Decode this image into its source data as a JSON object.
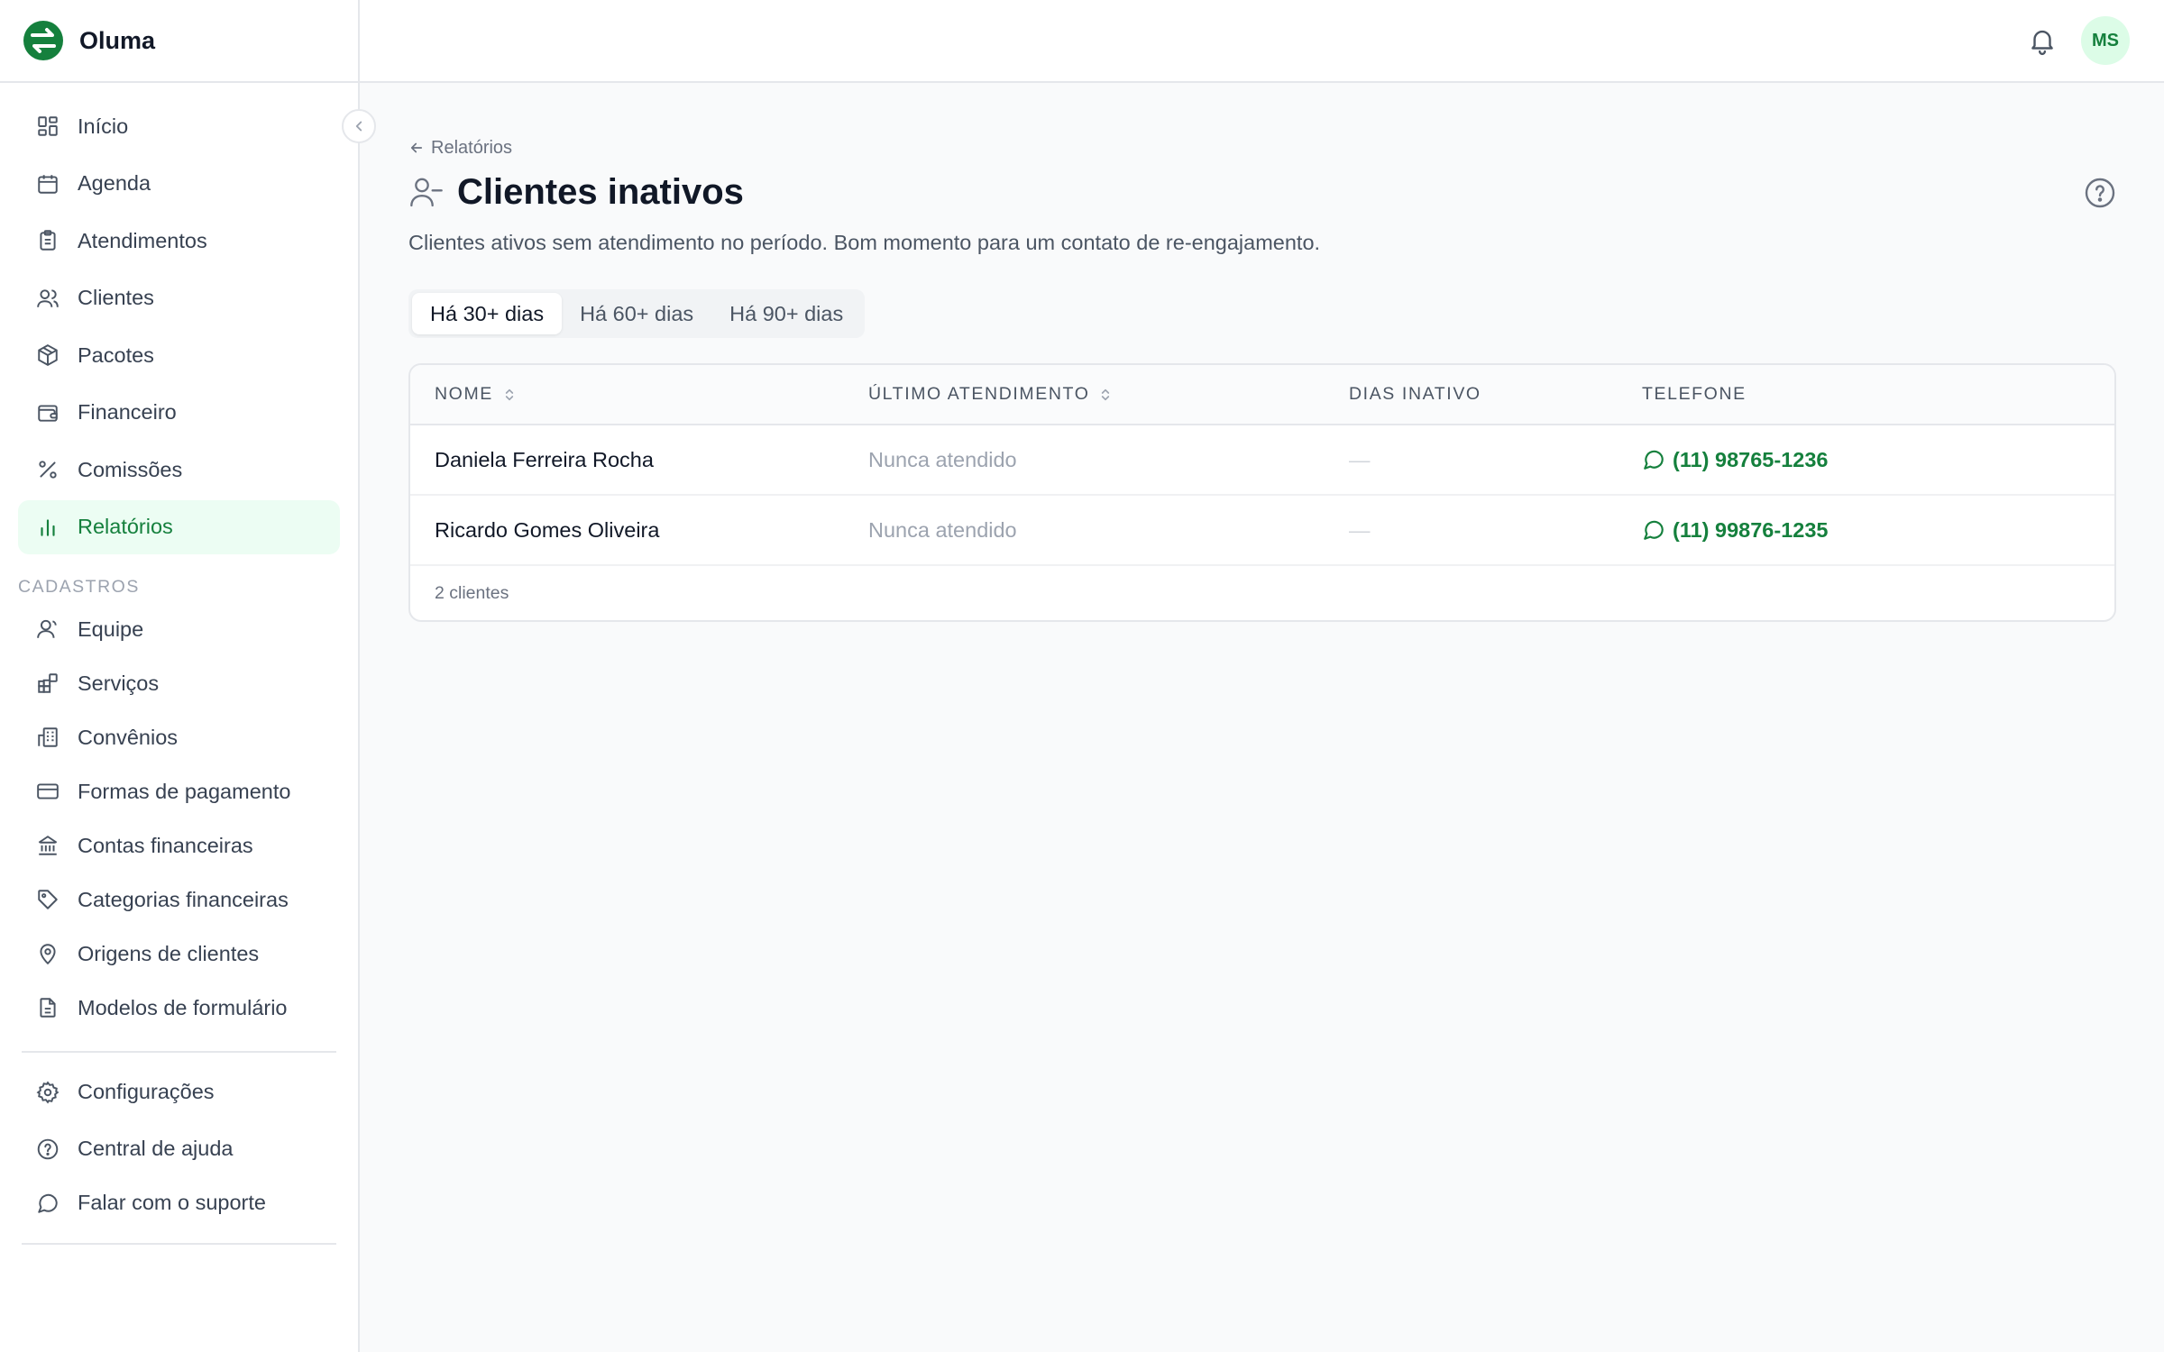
{
  "brand": {
    "name": "Oluma",
    "accent": "#15803d"
  },
  "sidebar": {
    "main_items": [
      {
        "label": "Início",
        "icon": "dashboard-icon"
      },
      {
        "label": "Agenda",
        "icon": "calendar-icon"
      },
      {
        "label": "Atendimentos",
        "icon": "clipboard-icon"
      },
      {
        "label": "Clientes",
        "icon": "users-icon"
      },
      {
        "label": "Pacotes",
        "icon": "package-icon"
      },
      {
        "label": "Financeiro",
        "icon": "wallet-icon"
      },
      {
        "label": "Comissões",
        "icon": "percent-icon"
      },
      {
        "label": "Relatórios",
        "icon": "bar-chart-icon",
        "active": true
      }
    ],
    "section_label": "CADASTROS",
    "cadastro_items": [
      {
        "label": "Equipe",
        "icon": "user-icon"
      },
      {
        "label": "Serviços",
        "icon": "blocks-icon"
      },
      {
        "label": "Convênios",
        "icon": "building-icon"
      },
      {
        "label": "Formas de pagamento",
        "icon": "credit-card-icon"
      },
      {
        "label": "Contas financeiras",
        "icon": "bank-icon"
      },
      {
        "label": "Categorias financeiras",
        "icon": "tag-icon"
      },
      {
        "label": "Origens de clientes",
        "icon": "map-pin-icon"
      },
      {
        "label": "Modelos de formulário",
        "icon": "file-text-icon"
      }
    ],
    "footer_items": [
      {
        "label": "Configurações",
        "icon": "gear-icon"
      },
      {
        "label": "Central de ajuda",
        "icon": "help-circle-icon"
      },
      {
        "label": "Falar com o suporte",
        "icon": "chat-icon"
      }
    ]
  },
  "topbar": {
    "avatar_initials": "MS"
  },
  "page": {
    "back_label": "Relatórios",
    "title": "Clientes inativos",
    "subtitle": "Clientes ativos sem atendimento no período. Bom momento para um contato de re-engajamento.",
    "tabs": [
      {
        "label": "Há 30+ dias",
        "active": true
      },
      {
        "label": "Há 60+ dias",
        "active": false
      },
      {
        "label": "Há 90+ dias",
        "active": false
      }
    ]
  },
  "table": {
    "headers": {
      "name": "NOME",
      "last": "ÚLTIMO ATENDIMENTO",
      "days": "DIAS INATIVO",
      "phone": "TELEFONE"
    },
    "rows": [
      {
        "name": "Daniela Ferreira Rocha",
        "last": "Nunca atendido",
        "days": "—",
        "phone": "(11) 98765-1236"
      },
      {
        "name": "Ricardo Gomes Oliveira",
        "last": "Nunca atendido",
        "days": "—",
        "phone": "(11) 99876-1235"
      }
    ],
    "footer": "2 clientes"
  }
}
